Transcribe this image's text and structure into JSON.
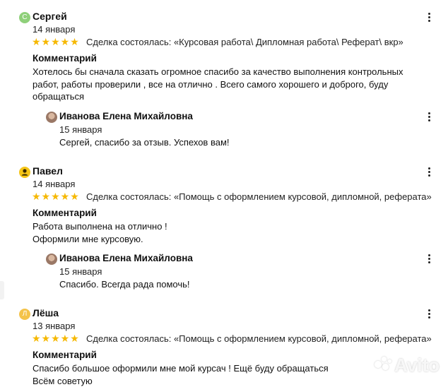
{
  "reviews": [
    {
      "avatar_letter": "С",
      "name": "Сергей",
      "date": "14 января",
      "stars": "★★★★★",
      "deal": "Сделка состоялась: «Курсовая работа\\ Дипломная работа\\ Реферат\\ вкр»",
      "comment_label": "Комментарий",
      "comment_lines": [
        "Хотелось бы сначала сказать огромное спасибо за качество выполнения контрольных",
        "работ, работы проверили , все на отлично . Всего самого хорошего и доброго, буду",
        "обращаться"
      ],
      "reply": {
        "name": "Иванова Елена Михайловна",
        "date": "15 января",
        "text": "Сергей, спасибо за отзыв. Успехов вам!"
      }
    },
    {
      "avatar_letter": "",
      "name": "Павел",
      "date": "14 января",
      "stars": "★★★★★",
      "deal": "Сделка состоялась: «Помощь с оформлением курсовой, дипломной, реферата»",
      "comment_label": "Комментарий",
      "comment_lines": [
        "Работа выполнена на отлично !",
        "Оформили мне курсовую."
      ],
      "reply": {
        "name": "Иванова Елена Михайловна",
        "date": "15 января",
        "text": "Спасибо. Всегда рада помочь!"
      }
    },
    {
      "avatar_letter": "Л",
      "name": "Лёша",
      "date": "13 января",
      "stars": "★★★★★",
      "deal": "Сделка состоялась: «Помощь с оформлением курсовой, дипломной, реферата»",
      "comment_label": "Комментарий",
      "comment_lines": [
        "Спасибо большое оформили мне мой курсач ! Ещё буду обращаться",
        "Всём советую"
      ]
    }
  ],
  "watermark": "Avito",
  "colors": {
    "star": "#f6b800",
    "avatar_green": "#8fd07a",
    "avatar_yellow": "#f5c518",
    "avatar_orange": "#f4c34a"
  }
}
